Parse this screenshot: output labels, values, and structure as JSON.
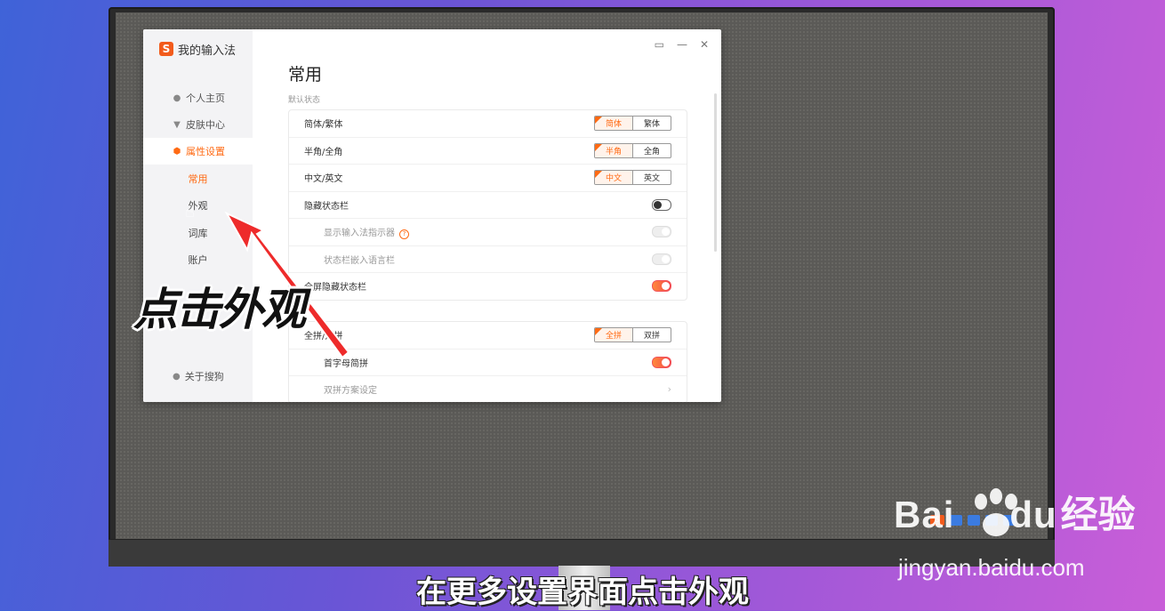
{
  "window": {
    "app_title": "我的输入法",
    "logo_letter": "S",
    "titlebar_icons": [
      "feedback-icon",
      "minimize-icon",
      "close-icon"
    ],
    "titlebar_glyphs": {
      "feedback": "▭",
      "minimize": "—",
      "close": "✕"
    }
  },
  "sidebar": {
    "items": [
      {
        "label": "个人主页",
        "icon": "person-icon"
      },
      {
        "label": "皮肤中心",
        "icon": "shirt-icon"
      },
      {
        "label": "属性设置",
        "icon": "settings-icon"
      }
    ],
    "sub_items": [
      "常用",
      "外观",
      "词库",
      "账户"
    ],
    "about": "关于搜狗"
  },
  "main": {
    "page_title": "常用",
    "section_label": "默认状态",
    "rows": [
      {
        "label": "简体/繁体",
        "options": [
          "简体",
          "繁体"
        ]
      },
      {
        "label": "半角/全角",
        "options": [
          "半角",
          "全角"
        ]
      },
      {
        "label": "中文/英文",
        "options": [
          "中文",
          "英文"
        ]
      },
      {
        "label": "隐藏状态栏",
        "toggle": "off"
      },
      {
        "label": "显示输入法指示器",
        "toggle": "disabled",
        "help": "?"
      },
      {
        "label": "状态栏嵌入语言栏",
        "toggle": "disabled"
      },
      {
        "label": "全屏隐藏状态栏",
        "toggle": "on"
      }
    ],
    "rows2": [
      {
        "label": "全拼/双拼",
        "options": [
          "全拼",
          "双拼"
        ]
      },
      {
        "label": "首字母简拼",
        "toggle": "on"
      },
      {
        "label": "双拼方案设定",
        "chevron": "›"
      }
    ]
  },
  "overlay": {
    "big_text": "点击外观",
    "caption": "在更多设置界面点击外观"
  },
  "watermark": {
    "brand": "Bai",
    "brand2": "du",
    "cn": "经验",
    "url": "jingyan.baidu.com"
  },
  "colors": {
    "accent": "#ff6a13",
    "arrow": "#ee2b2b"
  }
}
